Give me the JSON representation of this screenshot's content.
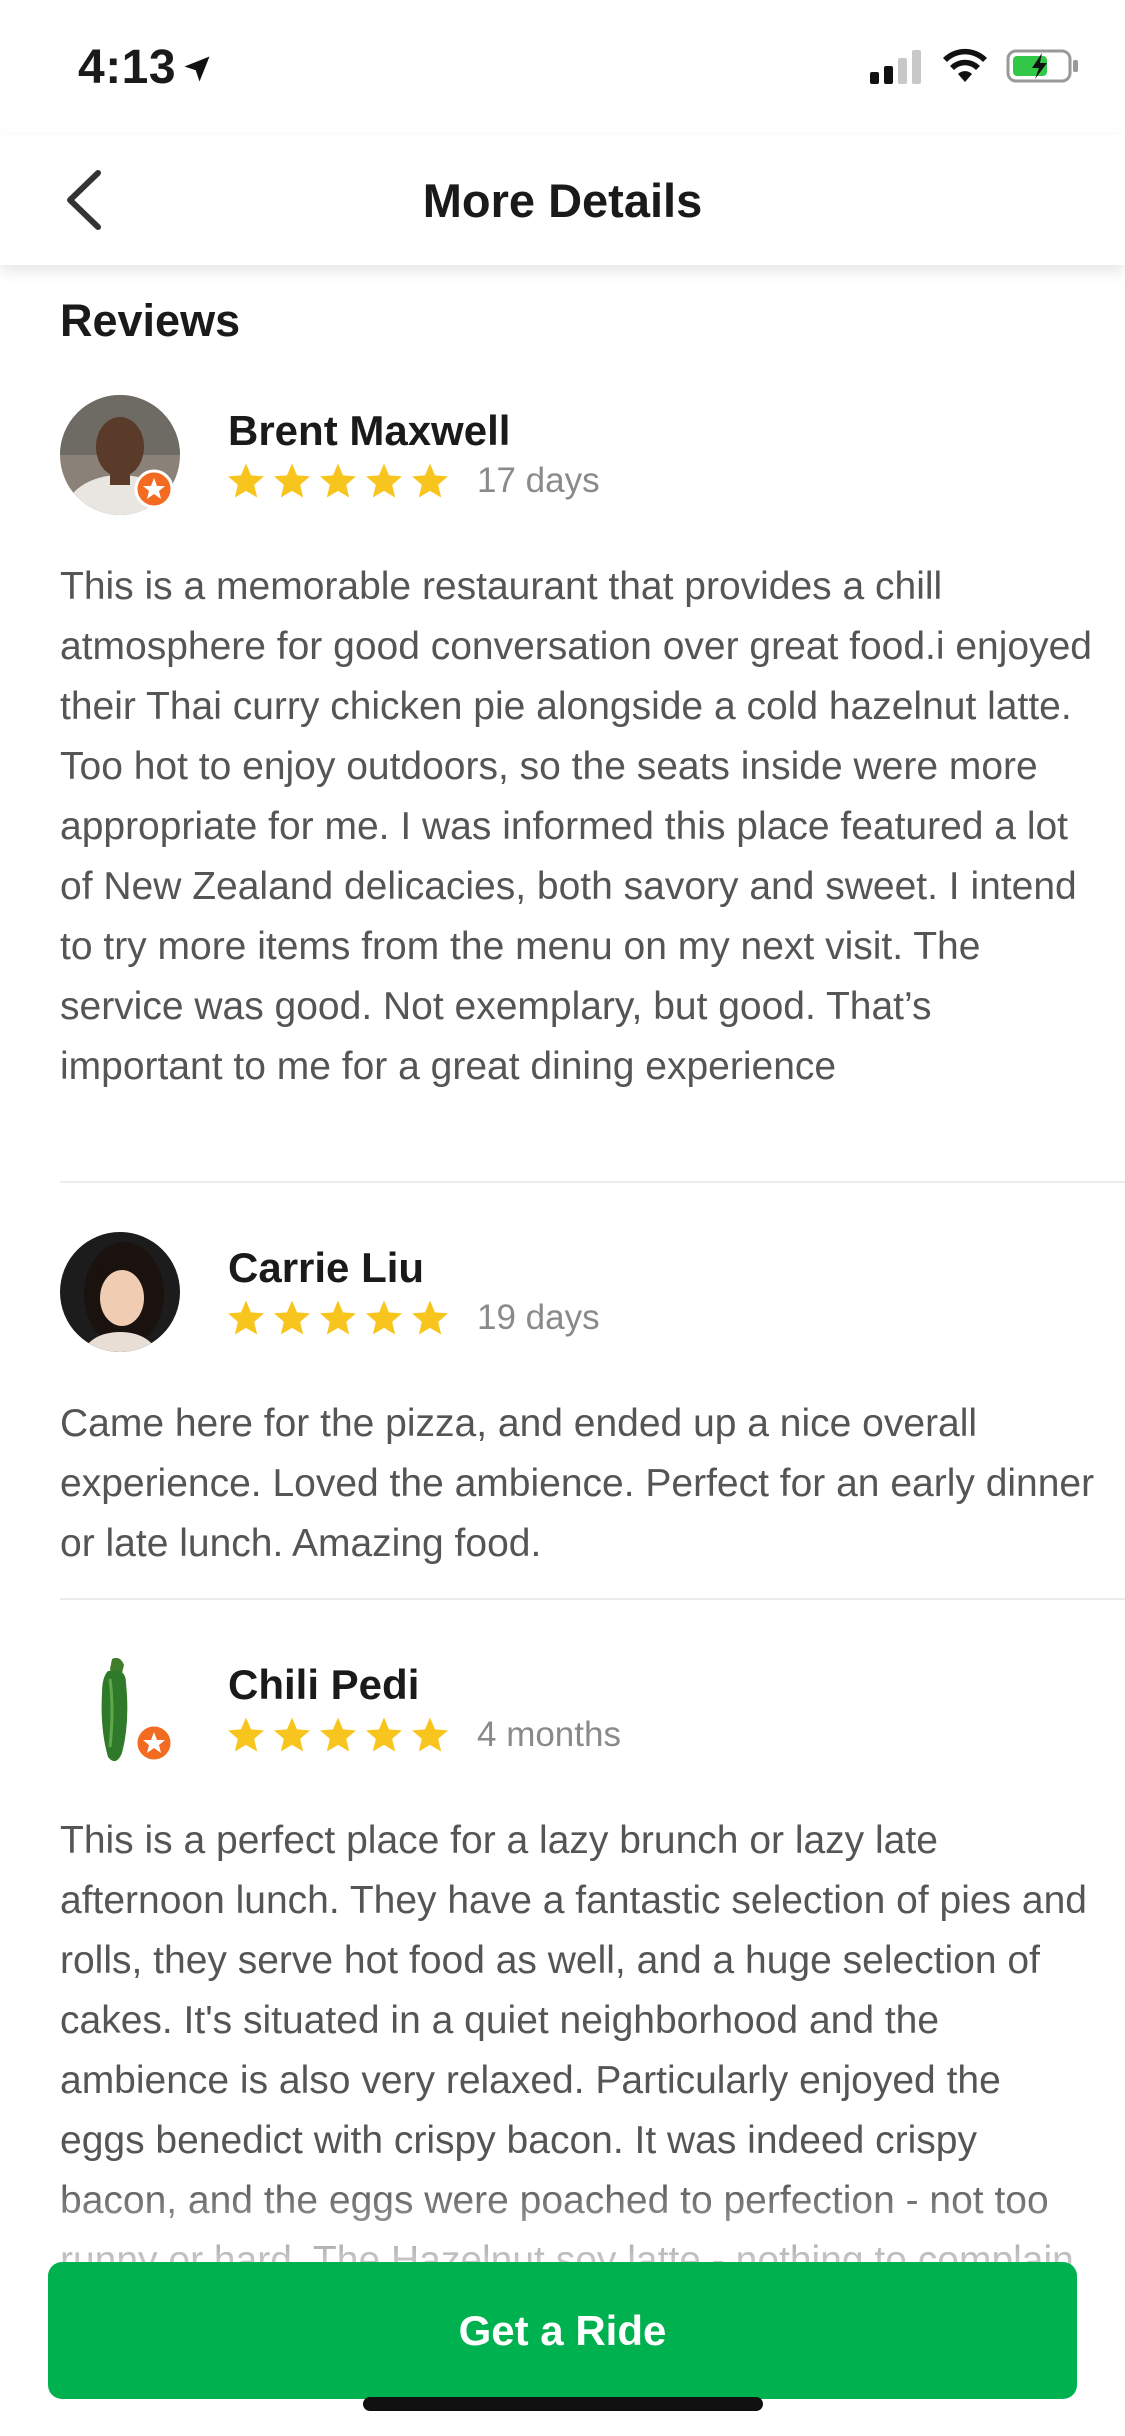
{
  "status_bar": {
    "time": "4:13"
  },
  "nav": {
    "title": "More Details"
  },
  "section": {
    "title": "Reviews"
  },
  "reviews": [
    {
      "name": "Brent Maxwell",
      "rating": 5,
      "date": "17 days",
      "badge": true,
      "text": "This is a memorable restaurant that provides a chill atmosphere for good conversation over great food.i enjoyed their Thai curry chicken pie alongside a cold hazelnut latte. Too hot to enjoy outdoors, so the seats inside were more appropriate for me. I was informed this place featured a lot of New Zealand delicacies, both savory and sweet. I intend to try more items from the menu on my next visit. The service was good. Not exemplary, but good. That’s important to me for a great dining experience"
    },
    {
      "name": "Carrie Liu",
      "rating": 5,
      "date": "19 days",
      "badge": false,
      "text": "Came here for the pizza, and ended up a nice overall experience. Loved the ambience. Perfect for an early dinner or late lunch. Amazing food."
    },
    {
      "name": "Chili Pedi",
      "rating": 5,
      "date": "4 months",
      "badge": true,
      "text": "This is a perfect place for a lazy brunch or lazy late afternoon lunch. They have a fantastic selection of pies and rolls, they serve hot food as well, and a huge selection of cakes. It's situated in a quiet neighborhood and the ambience is also very relaxed. Particularly enjoyed the eggs benedict with crispy bacon. It was indeed crispy bacon, and the eggs were poached to perfection - not too runny or hard. The Hazelnut soy latte - nothing to complain about. It"
    }
  ],
  "cta": {
    "label": "Get a Ride"
  },
  "colors": {
    "brand_green": "#00b14f",
    "star_yellow": "#f7c51e",
    "badge_orange": "#f26b21"
  }
}
